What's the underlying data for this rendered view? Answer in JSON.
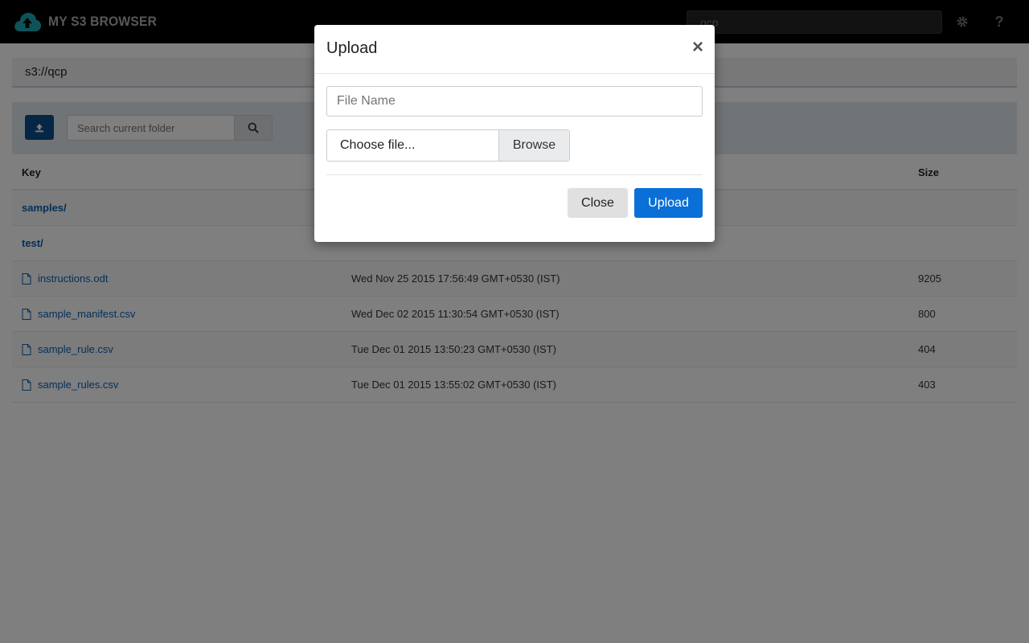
{
  "app": {
    "name": "MY S3 BROWSER"
  },
  "header": {
    "bucket_value": "qcp",
    "settings_icon": "gear-icon",
    "help_label": "?"
  },
  "path": {
    "current": "s3://qcp"
  },
  "toolbar": {
    "upload_icon": "upload-icon",
    "search_placeholder": "Search current folder",
    "search_icon": "search-icon"
  },
  "table": {
    "columns": {
      "key": "Key",
      "size": "Size"
    },
    "folders": [
      {
        "name": "samples/"
      },
      {
        "name": "test/"
      }
    ],
    "files": [
      {
        "name": "instructions.odt",
        "modified": "Wed Nov 25 2015 17:56:49 GMT+0530 (IST)",
        "size": "9205"
      },
      {
        "name": "sample_manifest.csv",
        "modified": "Wed Dec 02 2015 11:30:54 GMT+0530 (IST)",
        "size": "800"
      },
      {
        "name": "sample_rule.csv",
        "modified": "Tue Dec 01 2015 13:50:23 GMT+0530 (IST)",
        "size": "404"
      },
      {
        "name": "sample_rules.csv",
        "modified": "Tue Dec 01 2015 13:55:02 GMT+0530 (IST)",
        "size": "403"
      }
    ]
  },
  "modal": {
    "title": "Upload",
    "close_symbol": "×",
    "filename_placeholder": "File Name",
    "file_chooser_text": "Choose file...",
    "browse_label": "Browse",
    "close_label": "Close",
    "upload_label": "Upload"
  },
  "colors": {
    "navbar": "#000000",
    "brand_icon": "#1fa7b4",
    "primary": "#0a6fd6",
    "link": "#0b5fb3"
  }
}
